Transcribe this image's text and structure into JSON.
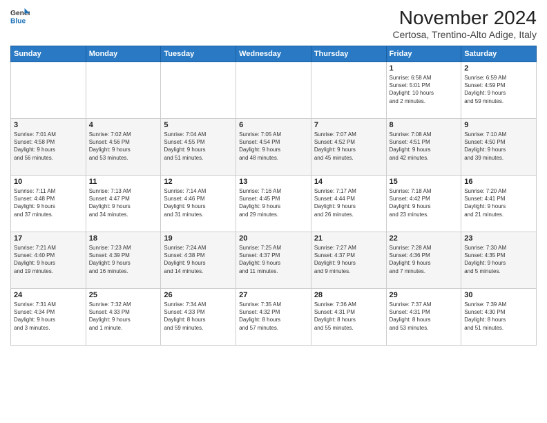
{
  "header": {
    "logo_line1": "General",
    "logo_line2": "Blue",
    "month": "November 2024",
    "location": "Certosa, Trentino-Alto Adige, Italy"
  },
  "weekdays": [
    "Sunday",
    "Monday",
    "Tuesday",
    "Wednesday",
    "Thursday",
    "Friday",
    "Saturday"
  ],
  "weeks": [
    [
      {
        "day": "",
        "info": ""
      },
      {
        "day": "",
        "info": ""
      },
      {
        "day": "",
        "info": ""
      },
      {
        "day": "",
        "info": ""
      },
      {
        "day": "",
        "info": ""
      },
      {
        "day": "1",
        "info": "Sunrise: 6:58 AM\nSunset: 5:01 PM\nDaylight: 10 hours\nand 2 minutes."
      },
      {
        "day": "2",
        "info": "Sunrise: 6:59 AM\nSunset: 4:59 PM\nDaylight: 9 hours\nand 59 minutes."
      }
    ],
    [
      {
        "day": "3",
        "info": "Sunrise: 7:01 AM\nSunset: 4:58 PM\nDaylight: 9 hours\nand 56 minutes."
      },
      {
        "day": "4",
        "info": "Sunrise: 7:02 AM\nSunset: 4:56 PM\nDaylight: 9 hours\nand 53 minutes."
      },
      {
        "day": "5",
        "info": "Sunrise: 7:04 AM\nSunset: 4:55 PM\nDaylight: 9 hours\nand 51 minutes."
      },
      {
        "day": "6",
        "info": "Sunrise: 7:05 AM\nSunset: 4:54 PM\nDaylight: 9 hours\nand 48 minutes."
      },
      {
        "day": "7",
        "info": "Sunrise: 7:07 AM\nSunset: 4:52 PM\nDaylight: 9 hours\nand 45 minutes."
      },
      {
        "day": "8",
        "info": "Sunrise: 7:08 AM\nSunset: 4:51 PM\nDaylight: 9 hours\nand 42 minutes."
      },
      {
        "day": "9",
        "info": "Sunrise: 7:10 AM\nSunset: 4:50 PM\nDaylight: 9 hours\nand 39 minutes."
      }
    ],
    [
      {
        "day": "10",
        "info": "Sunrise: 7:11 AM\nSunset: 4:48 PM\nDaylight: 9 hours\nand 37 minutes."
      },
      {
        "day": "11",
        "info": "Sunrise: 7:13 AM\nSunset: 4:47 PM\nDaylight: 9 hours\nand 34 minutes."
      },
      {
        "day": "12",
        "info": "Sunrise: 7:14 AM\nSunset: 4:46 PM\nDaylight: 9 hours\nand 31 minutes."
      },
      {
        "day": "13",
        "info": "Sunrise: 7:16 AM\nSunset: 4:45 PM\nDaylight: 9 hours\nand 29 minutes."
      },
      {
        "day": "14",
        "info": "Sunrise: 7:17 AM\nSunset: 4:44 PM\nDaylight: 9 hours\nand 26 minutes."
      },
      {
        "day": "15",
        "info": "Sunrise: 7:18 AM\nSunset: 4:42 PM\nDaylight: 9 hours\nand 23 minutes."
      },
      {
        "day": "16",
        "info": "Sunrise: 7:20 AM\nSunset: 4:41 PM\nDaylight: 9 hours\nand 21 minutes."
      }
    ],
    [
      {
        "day": "17",
        "info": "Sunrise: 7:21 AM\nSunset: 4:40 PM\nDaylight: 9 hours\nand 19 minutes."
      },
      {
        "day": "18",
        "info": "Sunrise: 7:23 AM\nSunset: 4:39 PM\nDaylight: 9 hours\nand 16 minutes."
      },
      {
        "day": "19",
        "info": "Sunrise: 7:24 AM\nSunset: 4:38 PM\nDaylight: 9 hours\nand 14 minutes."
      },
      {
        "day": "20",
        "info": "Sunrise: 7:25 AM\nSunset: 4:37 PM\nDaylight: 9 hours\nand 11 minutes."
      },
      {
        "day": "21",
        "info": "Sunrise: 7:27 AM\nSunset: 4:37 PM\nDaylight: 9 hours\nand 9 minutes."
      },
      {
        "day": "22",
        "info": "Sunrise: 7:28 AM\nSunset: 4:36 PM\nDaylight: 9 hours\nand 7 minutes."
      },
      {
        "day": "23",
        "info": "Sunrise: 7:30 AM\nSunset: 4:35 PM\nDaylight: 9 hours\nand 5 minutes."
      }
    ],
    [
      {
        "day": "24",
        "info": "Sunrise: 7:31 AM\nSunset: 4:34 PM\nDaylight: 9 hours\nand 3 minutes."
      },
      {
        "day": "25",
        "info": "Sunrise: 7:32 AM\nSunset: 4:33 PM\nDaylight: 9 hours\nand 1 minute."
      },
      {
        "day": "26",
        "info": "Sunrise: 7:34 AM\nSunset: 4:33 PM\nDaylight: 8 hours\nand 59 minutes."
      },
      {
        "day": "27",
        "info": "Sunrise: 7:35 AM\nSunset: 4:32 PM\nDaylight: 8 hours\nand 57 minutes."
      },
      {
        "day": "28",
        "info": "Sunrise: 7:36 AM\nSunset: 4:31 PM\nDaylight: 8 hours\nand 55 minutes."
      },
      {
        "day": "29",
        "info": "Sunrise: 7:37 AM\nSunset: 4:31 PM\nDaylight: 8 hours\nand 53 minutes."
      },
      {
        "day": "30",
        "info": "Sunrise: 7:39 AM\nSunset: 4:30 PM\nDaylight: 8 hours\nand 51 minutes."
      }
    ]
  ]
}
